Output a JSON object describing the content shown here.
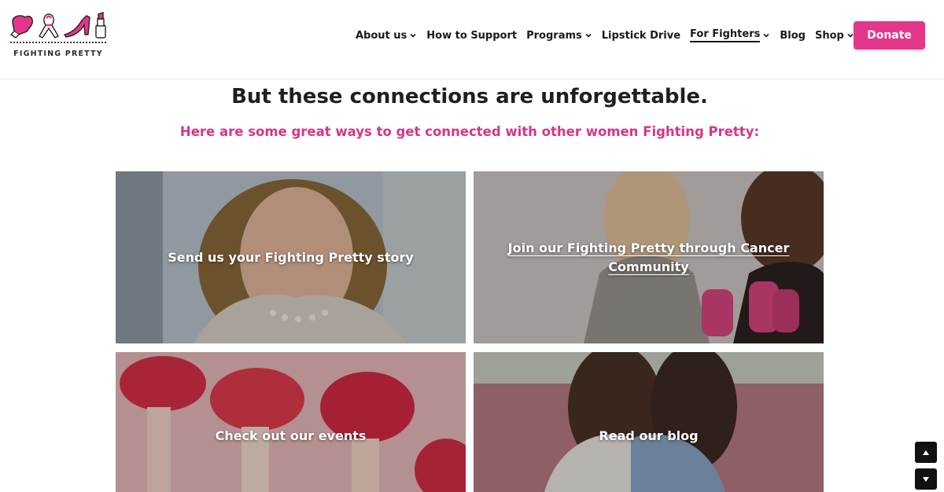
{
  "brand": {
    "name": "FIGHTING PRETTY",
    "icons": [
      "boxing-glove-icon",
      "ribbon-icon",
      "high-heel-icon",
      "lipstick-icon"
    ],
    "accent_color": "#e4378c"
  },
  "nav": {
    "items": [
      {
        "label": "About us",
        "has_dropdown": true
      },
      {
        "label": "How to Support",
        "has_dropdown": false
      },
      {
        "label": "Programs",
        "has_dropdown": true
      },
      {
        "label": "Lipstick Drive",
        "has_dropdown": false
      },
      {
        "label": "For Fighters",
        "has_dropdown": true,
        "active": true
      },
      {
        "label": "Blog",
        "has_dropdown": false
      },
      {
        "label": "Shop",
        "has_dropdown": true
      }
    ],
    "search_icon": "search-icon",
    "donate_label": "Donate"
  },
  "main": {
    "headline": "But these connections are unforgettable.",
    "subhead": "Here are some great ways to get connected with other women Fighting Pretty:",
    "tiles": [
      {
        "caption": "Send us your Fighting Pretty story"
      },
      {
        "caption": "Join our Fighting Pretty through Cancer Community"
      },
      {
        "caption": "Check out our events"
      },
      {
        "caption": "Read our blog"
      }
    ]
  },
  "scroll": {
    "up_icon": "arrow-up-icon",
    "down_icon": "arrow-down-icon"
  }
}
